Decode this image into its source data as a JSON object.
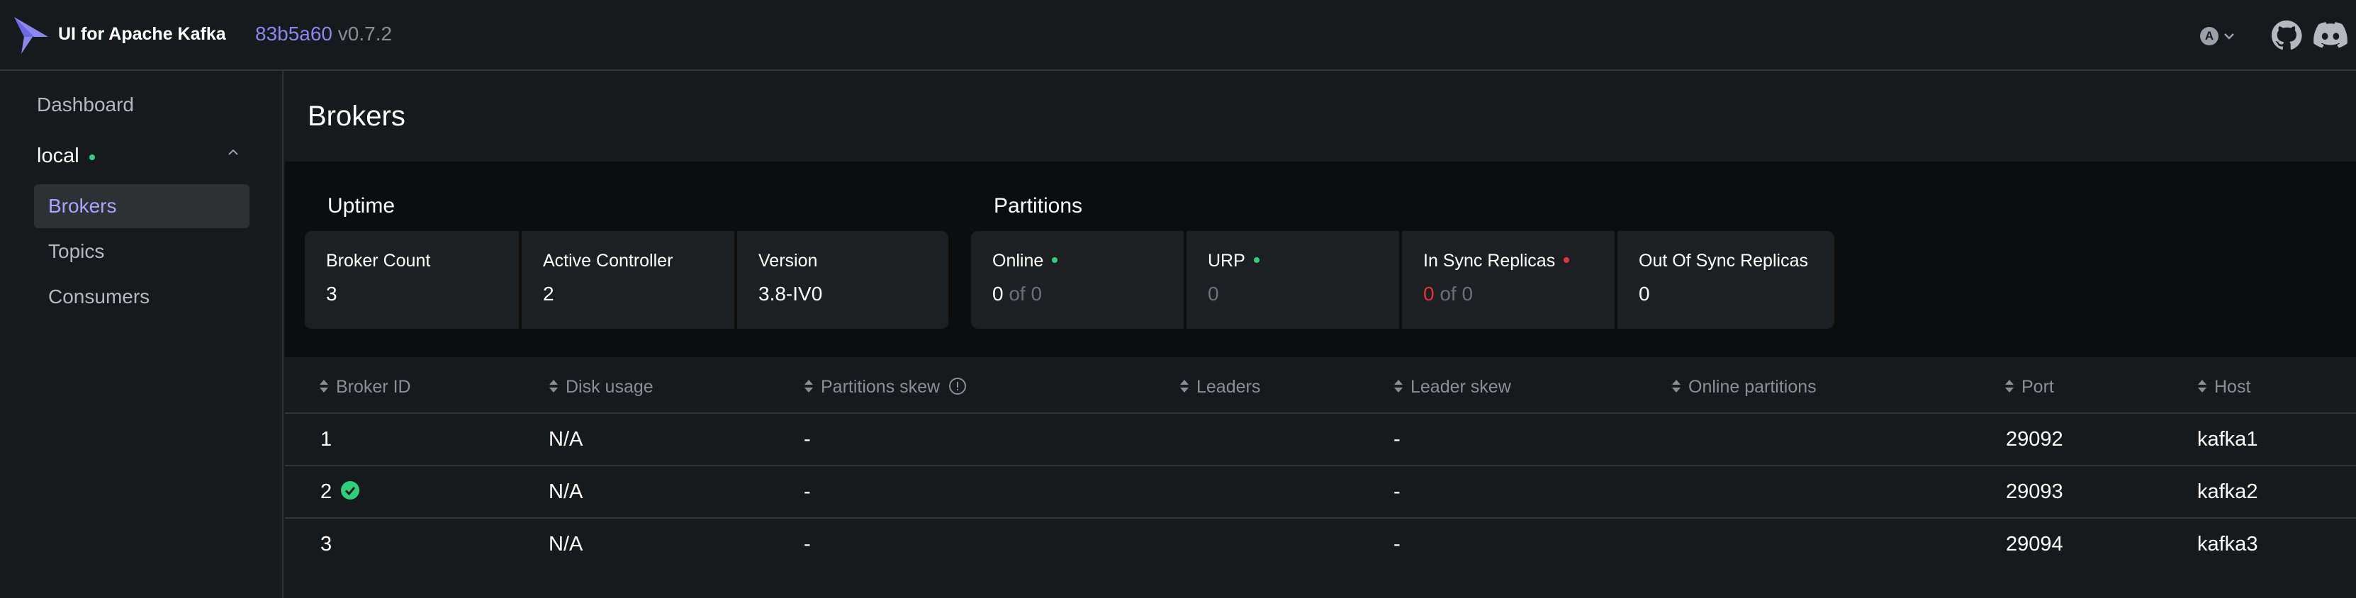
{
  "header": {
    "app_title": "UI for Apache Kafka",
    "version_hash": "83b5a60",
    "version": "v0.7.2",
    "avatar_letter": "A"
  },
  "sidebar": {
    "dashboard": "Dashboard",
    "cluster": "local",
    "cluster_status": "online",
    "items": [
      {
        "label": "Brokers",
        "active": true
      },
      {
        "label": "Topics",
        "active": false
      },
      {
        "label": "Consumers",
        "active": false
      }
    ]
  },
  "page": {
    "title": "Brokers"
  },
  "uptime": {
    "title": "Uptime",
    "broker_count_label": "Broker Count",
    "broker_count": "3",
    "active_controller_label": "Active Controller",
    "active_controller": "2",
    "version_label": "Version",
    "version": "3.8-IV0"
  },
  "partitions": {
    "title": "Partitions",
    "online_label": "Online",
    "online_value": "0",
    "online_total": "of 0",
    "urp_label": "URP",
    "urp_value": "0",
    "in_sync_label": "In Sync Replicas",
    "in_sync_value": "0",
    "in_sync_total": "of 0",
    "out_sync_label": "Out Of Sync Replicas",
    "out_sync_value": "0"
  },
  "table": {
    "columns": [
      "Broker ID",
      "Disk usage",
      "Partitions skew",
      "Leaders",
      "Leader skew",
      "Online partitions",
      "Port",
      "Host"
    ],
    "rows": [
      {
        "id": "1",
        "disk": "N/A",
        "pskew": "-",
        "leaders": "",
        "lskew": "-",
        "online": "",
        "port": "29092",
        "host": "kafka1",
        "controller": false
      },
      {
        "id": "2",
        "disk": "N/A",
        "pskew": "-",
        "leaders": "",
        "lskew": "-",
        "online": "",
        "port": "29093",
        "host": "kafka2",
        "controller": true
      },
      {
        "id": "3",
        "disk": "N/A",
        "pskew": "-",
        "leaders": "",
        "lskew": "-",
        "online": "",
        "port": "29094",
        "host": "kafka3",
        "controller": false
      }
    ]
  },
  "colors": {
    "accent": "#8b86f0",
    "green": "#2fd07a",
    "red": "#e5333b"
  }
}
